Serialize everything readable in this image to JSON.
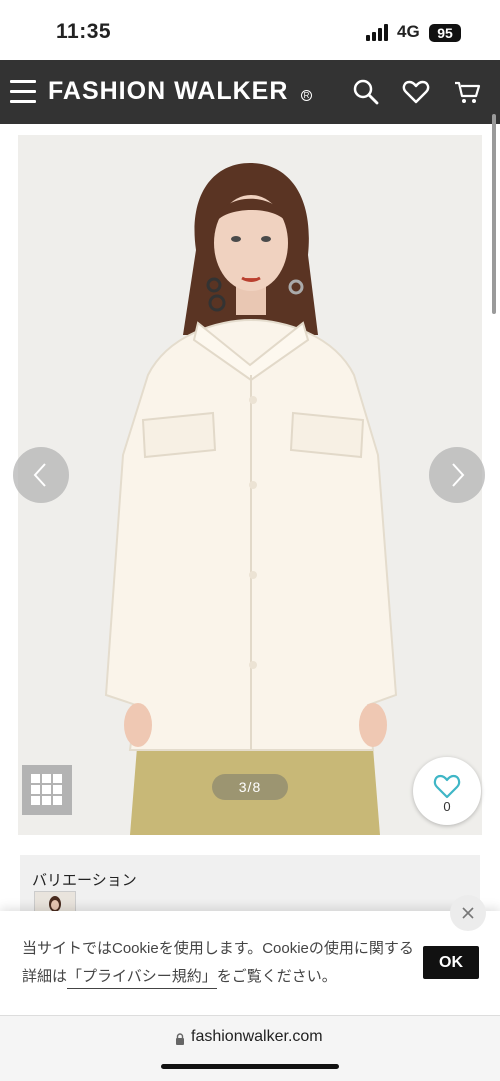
{
  "status_bar": {
    "time": "11:35",
    "network": "4G",
    "battery": "95"
  },
  "header": {
    "logo": "FASHION WALKER",
    "logo_mark": "R",
    "icons": [
      "menu-icon",
      "search-icon",
      "heart-icon",
      "cart-icon"
    ]
  },
  "gallery": {
    "counter": "3/8",
    "favorite_count": "0"
  },
  "variation": {
    "label": "バリエーション"
  },
  "cookie": {
    "text_before": "当サイトではCookieを使用します。Cookieの使用に関する詳細は",
    "link": "「プライバシー規約」",
    "text_after": "をご覧ください。",
    "ok_label": "OK"
  },
  "browser": {
    "url": "fashionwalker.com"
  },
  "colors": {
    "header_bg": "#333333",
    "favorite": "#3fb6c6",
    "ok_button": "#111111"
  }
}
